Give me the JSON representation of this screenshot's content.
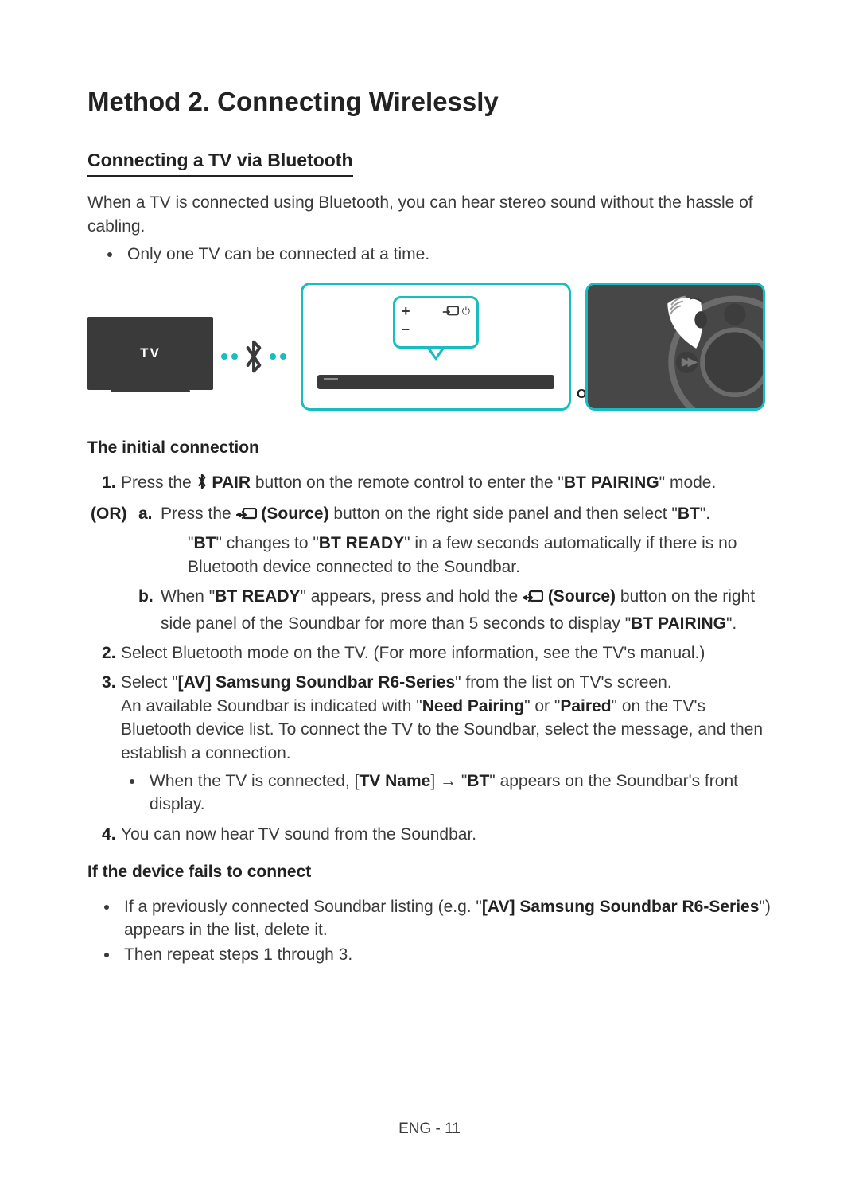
{
  "title": "Method 2. Connecting Wirelessly",
  "section1": {
    "heading": "Connecting a TV via Bluetooth",
    "intro": "When a TV is connected using Bluetooth, you can hear stereo sound without the hassle of cabling.",
    "bullet": "Only one TV can be connected at a time."
  },
  "figure": {
    "tv_label": "TV",
    "or_label": "OR"
  },
  "initial": {
    "heading": "The initial connection",
    "or_badge": "(OR)",
    "s1_a": "Press the ",
    "s1_pair": " PAIR",
    "s1_b": " button on the remote control to enter the \"",
    "s1_btp": "BT PAIRING",
    "s1_c": "\" mode.",
    "sa_a": "Press the ",
    "sa_src": " (Source)",
    "sa_b": " button on the right side panel and then select \"",
    "sa_bt": "BT",
    "sa_c": "\".",
    "sa_line2_a": "\"",
    "sa_line2_bt": "BT",
    "sa_line2_b": "\" changes to \"",
    "sa_line2_btr": "BT READY",
    "sa_line2_c": "\" in a few seconds automatically if there is no Bluetooth device connected to the Soundbar.",
    "sb_a": "When \"",
    "sb_btr": "BT READY",
    "sb_b": "\" appears, press and hold the ",
    "sb_src": " (Source)",
    "sb_c": " button on the right side panel of the Soundbar for more than 5 seconds to display \"",
    "sb_btp": "BT PAIRING",
    "sb_d": "\".",
    "s2": "Select Bluetooth mode on the TV. (For more information, see the TV's manual.)",
    "s3_a": "Select \"",
    "s3_av": "[AV] Samsung Soundbar R6-Series",
    "s3_b": "\" from the list on TV's screen.",
    "s3_line2_a": "An available Soundbar is indicated with \"",
    "s3_np": "Need Pairing",
    "s3_line2_b": "\" or \"",
    "s3_pd": "Paired",
    "s3_line2_c": "\" on the TV's Bluetooth device list. To connect the TV to the Soundbar, select the message, and then establish a connection.",
    "s3_bul_a": "When the TV is connected, [",
    "s3_tvn": "TV Name",
    "s3_bul_b": "] → \"",
    "s3_bt": "BT",
    "s3_bul_c": "\" appears on the Soundbar's front display.",
    "s4": "You can now hear TV sound from the Soundbar."
  },
  "fail": {
    "heading": "If the device fails to connect",
    "b1_a": "If a previously connected Soundbar listing (e.g. \"",
    "b1_av": "[AV] Samsung Soundbar R6-Series",
    "b1_b": "\") appears in the list, delete it.",
    "b2": "Then repeat steps 1 through 3."
  },
  "footer": "ENG - 11"
}
